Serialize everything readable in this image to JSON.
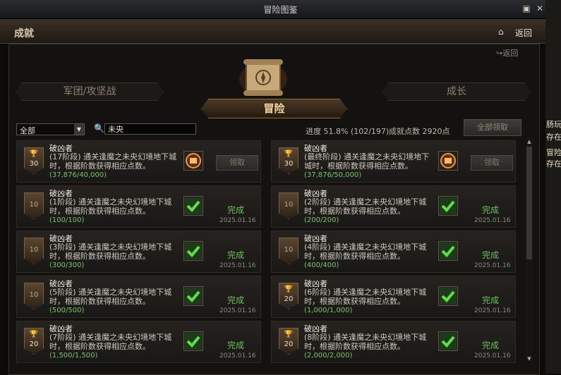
{
  "window": {
    "title": "冒险图鉴"
  },
  "header": {
    "section": "成就",
    "back_label": "返回"
  },
  "top_back_label": "返回",
  "tabs": {
    "left": "军团/攻坚战",
    "center": "冒险",
    "right": "成长"
  },
  "filter": {
    "selected": "全部"
  },
  "search": {
    "value": "未央"
  },
  "progress": {
    "label": "进度",
    "value": "51.8% (102/197)"
  },
  "points": {
    "label": "成就点数",
    "value": "2920点"
  },
  "claim_all_label": "全部领取",
  "achievements": [
    {
      "name": "破凶者",
      "desc": "(17阶段) 通关逢魔之未央幻境地下城时，根据阶数获得相应点数。",
      "progress": "(37,876/40,000)",
      "points": "30",
      "trophy": true,
      "status": "claim",
      "button": "领取"
    },
    {
      "name": "破凶者",
      "desc": "(最终阶段) 通关逢魔之未央幻境地下城时，根据阶数获得相应点数。",
      "progress": "(37,876/50,000)",
      "points": "30",
      "trophy": true,
      "status": "claim",
      "button": "领取"
    },
    {
      "name": "破凶者",
      "desc": "(1阶段) 通关逢魔之未央幻境地下城时，根据阶数获得相应点数。",
      "progress": "(100/100)",
      "points": "10",
      "trophy": false,
      "status": "done",
      "done_label": "完成",
      "date": "2025.01.16"
    },
    {
      "name": "破凶者",
      "desc": "(2阶段) 通关逢魔之未央幻境地下城时，根据阶数获得相应点数。",
      "progress": "(200/200)",
      "points": "10",
      "trophy": false,
      "status": "done",
      "done_label": "完成",
      "date": "2025.01.16"
    },
    {
      "name": "破凶者",
      "desc": "(3阶段) 通关逢魔之未央幻境地下城时，根据阶数获得相应点数。",
      "progress": "(300/300)",
      "points": "10",
      "trophy": false,
      "status": "done",
      "done_label": "完成",
      "date": "2025.01.16"
    },
    {
      "name": "破凶者",
      "desc": "(4阶段) 通关逢魔之未央幻境地下城时，根据阶数获得相应点数。",
      "progress": "(400/400)",
      "points": "10",
      "trophy": false,
      "status": "done",
      "done_label": "完成",
      "date": "2025.01.16"
    },
    {
      "name": "破凶者",
      "desc": "(5阶段) 通关逢魔之未央幻境地下城时，根据阶数获得相应点数。",
      "progress": "(500/500)",
      "points": "10",
      "trophy": false,
      "status": "done",
      "done_label": "完成",
      "date": "2025.01.16"
    },
    {
      "name": "破凶者",
      "desc": "(6阶段) 通关逢魔之未央幻境地下城时，根据阶数获得相应点数。",
      "progress": "(1,000/1,000)",
      "points": "20",
      "trophy": true,
      "status": "done",
      "done_label": "完成",
      "date": "2025.01.16"
    },
    {
      "name": "破凶者",
      "desc": "(7阶段) 通关逢魔之未央幻境地下城时，根据阶数获得相应点数。",
      "progress": "(1,500/1,500)",
      "points": "20",
      "trophy": true,
      "status": "done",
      "done_label": "完成",
      "date": "2025.01.16"
    },
    {
      "name": "破凶者",
      "desc": "(8阶段) 通关逢魔之未央幻境地下城时，根据阶数获得相应点数。",
      "progress": "(2,000/2,000)",
      "points": "20",
      "trophy": true,
      "status": "done",
      "done_label": "完成",
      "date": "2025.01.16"
    }
  ],
  "side_panel": {
    "text_1": "肠玩",
    "text_2": "存在",
    "text_3": "冒险",
    "text_4": "存在"
  },
  "icons": {
    "home": "home-icon",
    "back": "back-arrow-icon",
    "search": "search-icon",
    "reward": "reward-box-icon",
    "check": "checkmark-icon",
    "trophy": "trophy-icon"
  },
  "colors": {
    "accent": "#8b6b3f",
    "done": "#6fbf5e",
    "progress": "#77c46a"
  }
}
